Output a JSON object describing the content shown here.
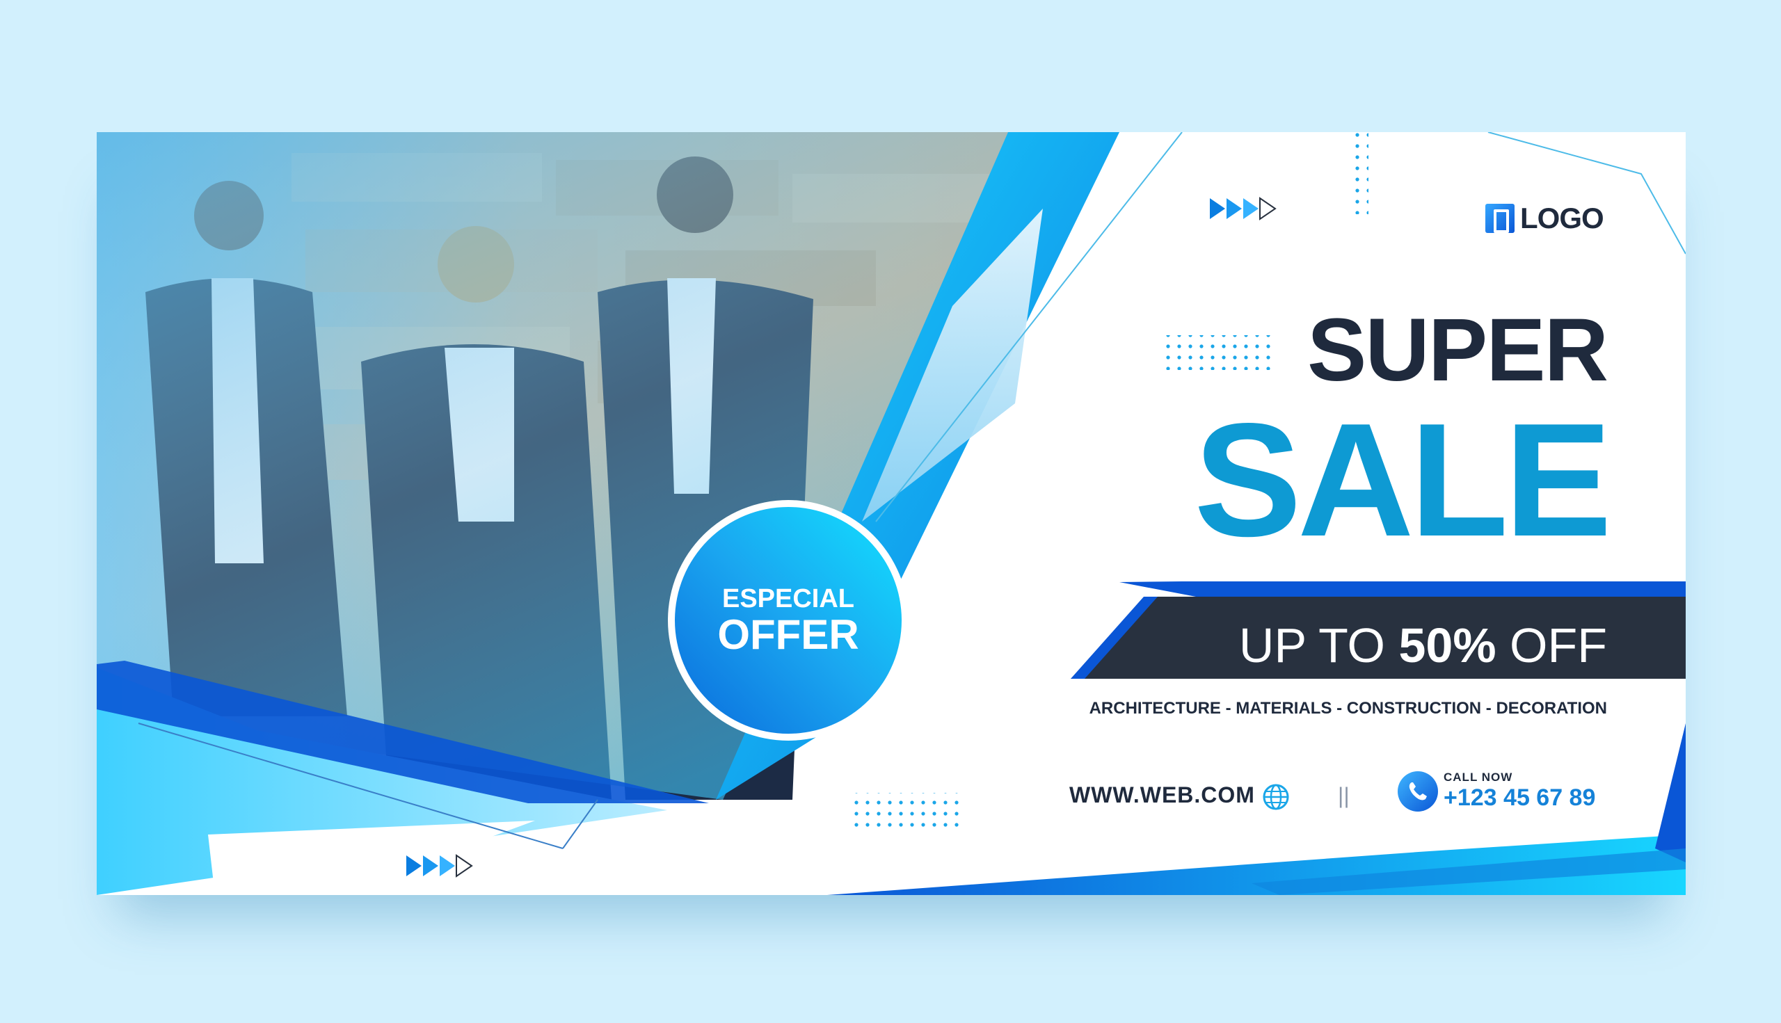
{
  "banner": {
    "logo_text": "LOGO",
    "title_line1": "SUPER",
    "title_line2": "SALE",
    "discount_prefix": "UP TO",
    "discount_value": "50%",
    "discount_suffix": "OFF",
    "categories": "ARCHITECTURE - MATERIALS - CONSTRUCTION - DECORATION",
    "website": "WWW.WEB.COM",
    "separator": "||",
    "call_label": "CALL NOW",
    "phone": "+123 45 67 89",
    "offer_line1": "ESPECIAL",
    "offer_line2": "OFFER"
  },
  "colors": {
    "background": "#d2f0fd",
    "dark_navy": "#1f2a3d",
    "accent_blue": "#0e9ad3",
    "cyan": "#14d4ff",
    "deep_blue": "#0a56d6"
  },
  "icons": {
    "globe": "globe-icon",
    "phone": "phone-icon",
    "logo": "logo-mark-icon",
    "arrows": "triangle-arrows-icon"
  }
}
